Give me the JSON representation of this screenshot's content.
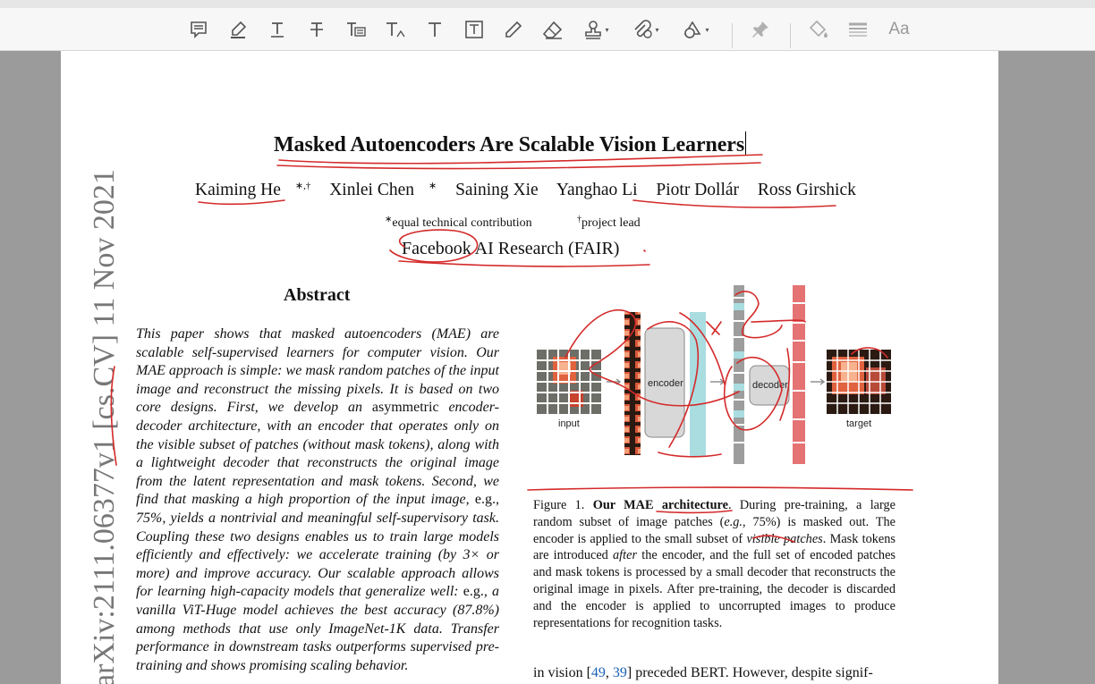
{
  "toolbar": {
    "tools": [
      {
        "name": "comment-tool",
        "icon": "comment-icon"
      },
      {
        "name": "highlight-tool",
        "icon": "highlighter-icon"
      },
      {
        "name": "underline-text-tool",
        "icon": "underline-text-icon"
      },
      {
        "name": "strikethrough-text-tool",
        "icon": "strikethrough-text-icon"
      },
      {
        "name": "replace-text-tool",
        "icon": "replace-text-icon"
      },
      {
        "name": "insert-text-tool",
        "icon": "insert-text-icon"
      },
      {
        "name": "add-text-tool",
        "icon": "add-text-icon"
      },
      {
        "name": "text-box-tool",
        "icon": "text-box-icon"
      },
      {
        "name": "draw-tool",
        "icon": "pencil-icon"
      },
      {
        "name": "eraser-tool",
        "icon": "eraser-icon"
      },
      {
        "name": "stamp-tool",
        "icon": "stamp-icon"
      },
      {
        "name": "attach-file-tool",
        "icon": "attach-file-icon"
      },
      {
        "name": "shapes-tool",
        "icon": "shapes-icon"
      },
      {
        "name": "pin-tool",
        "icon": "pin-icon"
      },
      {
        "name": "fill-color-tool",
        "icon": "paint-bucket-icon"
      },
      {
        "name": "line-thickness-tool",
        "icon": "line-thickness-icon"
      }
    ],
    "font_tool_label": "Aa"
  },
  "paper": {
    "title": "Masked Autoencoders Are Scalable Vision Learners",
    "authors": [
      {
        "name": "Kaiming He",
        "mark": "∗,†"
      },
      {
        "name": "Xinlei Chen",
        "mark": "∗"
      },
      {
        "name": "Saining Xie",
        "mark": ""
      },
      {
        "name": "Yanghao Li",
        "mark": ""
      },
      {
        "name": "Piotr Dollár",
        "mark": ""
      },
      {
        "name": "Ross Girshick",
        "mark": ""
      }
    ],
    "note_equal_mark": "∗",
    "note_equal": "equal technical contribution",
    "note_lead_mark": "†",
    "note_lead": "project lead",
    "affiliation": "Facebook AI Research (FAIR)",
    "abstract_heading": "Abstract",
    "abstract_parts": [
      "This paper shows that masked autoencoders (MAE) are scalable self-supervised learners for computer vision. Our MAE approach is simple: we mask random patches of the input image and reconstruct the missing pixels. It is based on two core designs. First, we develop an ",
      "asymmetric",
      " encoder-decoder architecture, with an encoder that operates only on the visible subset of patches (without mask tokens), along with a lightweight decoder that reconstructs the original image from the latent representation and mask tokens. Second, we find that masking a high proportion of the input image, ",
      "e.g.",
      ", 75%, yields a nontrivial and meaningful self-supervisory task. Coupling these two designs enables us to train large models efficiently and effectively: we accelerate training (by 3× or more) and improve accuracy. Our scalable approach allows for learning high-capacity models that generalize well: ",
      "e.g.",
      ", a vanilla ViT-Huge model achieves the best accuracy (87.8%) among methods that use only ImageNet-1K data. Transfer performance in downstream tasks outperforms supervised pre-training and shows promising scaling behavior."
    ],
    "arxiv_id": "arXiv:2111.06377v1  [cs.CV]  11 Nov 2021",
    "figure": {
      "input_label": "input",
      "encoder_label": "encoder",
      "decoder_label": "decoder",
      "target_label": "target"
    },
    "caption": {
      "fig_label": "Figure 1.",
      "bold": "Our MAE architecture",
      "p1": ". During pre-training, a large random subset of image patches (",
      "eg": "e.g.",
      "p2": ", 75%) is masked out. The encoder is applied to the small subset of ",
      "visible": "visible patches",
      "p3": ". Mask tokens are introduced ",
      "after": "after",
      "p4": " the encoder, and the full set of encoded patches and mask tokens is processed by a small decoder that reconstructs the original image in pixels. After pre-training, the decoder is discarded and the encoder is applied to uncorrupted images to produce representations for recognition tasks."
    },
    "body": {
      "pre": "in vision [",
      "ref1": "49",
      "sep": ", ",
      "ref2": "39",
      "post": "] preceded BERT. However, despite signif-"
    }
  },
  "colors": {
    "ink": "#d42a2a",
    "link": "#1a5fb4",
    "patch_grey": "#6e6e68",
    "token_cyan": "#a9dde0",
    "token_red": "#e57373"
  }
}
